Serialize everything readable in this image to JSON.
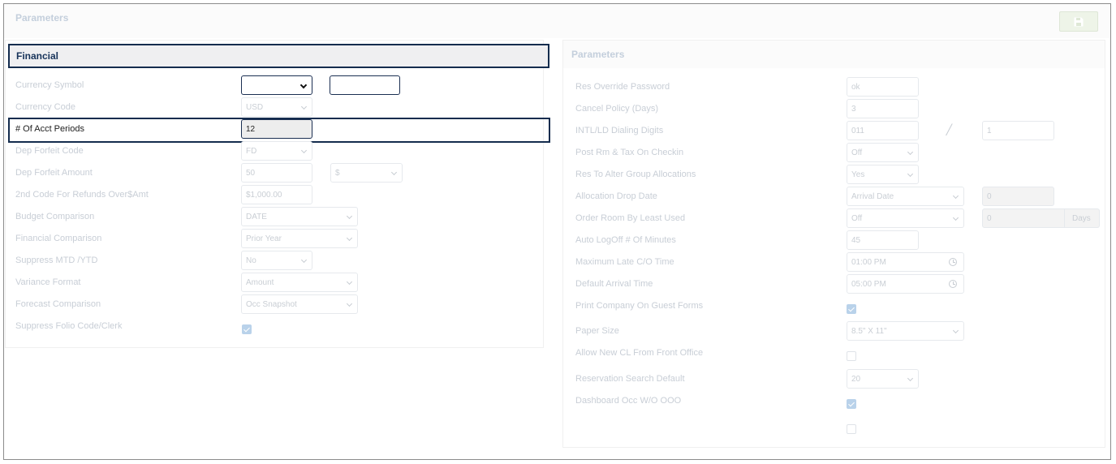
{
  "header": {
    "title": "Parameters",
    "save_icon": "save-icon"
  },
  "financial": {
    "title": "Financial",
    "rows": [
      {
        "label": "Currency Symbol",
        "value": "",
        "value2": ""
      },
      {
        "label": "Currency Code",
        "value": "USD"
      },
      {
        "label": "# Of Acct Periods",
        "value": "12"
      },
      {
        "label": "Dep Forfeit Code",
        "value": "FD"
      },
      {
        "label": "Dep Forfeit Amount",
        "value": "50",
        "value2": "$"
      },
      {
        "label": "2nd Code For Refunds Over$Amt",
        "value": "$1,000.00"
      },
      {
        "label": "Budget Comparison",
        "value": "DATE"
      },
      {
        "label": "Financial Comparison",
        "value": "Prior Year"
      },
      {
        "label": "Suppress MTD /YTD",
        "value": "No"
      },
      {
        "label": "Variance Format",
        "value": "Amount"
      },
      {
        "label": "Forecast Comparison",
        "value": "Occ Snapshot"
      },
      {
        "label": "Suppress Folio Code/Clerk",
        "checked": true
      }
    ]
  },
  "parameters": {
    "title": "Parameters",
    "rows": [
      {
        "label": "Res Override Password",
        "value": "ok"
      },
      {
        "label": "Cancel Policy (Days)",
        "value": "3"
      },
      {
        "label": "INTL/LD Dialing Digits",
        "value": "011",
        "separator": "/",
        "value2": "1"
      },
      {
        "label": "Post Rm & Tax On Checkin",
        "value": "Off"
      },
      {
        "label": "Res To Alter Group Allocations",
        "value": "Yes"
      },
      {
        "label": "Allocation Drop Date",
        "value": "Arrival Date",
        "value2": "0"
      },
      {
        "label": "Order Room By Least Used",
        "value": "Off",
        "value2": "0",
        "addon": "Days"
      },
      {
        "label": "Auto LogOff # Of Minutes",
        "value": "45"
      },
      {
        "label": "Maximum Late C/O Time",
        "value": "01:00 PM"
      },
      {
        "label": "Default Arrival Time",
        "value": "05:00 PM"
      },
      {
        "label": "Print Company On Guest Forms",
        "checked": true
      },
      {
        "label": "Paper Size",
        "value": "8.5\" X 11\""
      },
      {
        "label": "Allow New CL From Front Office",
        "checked": false
      },
      {
        "label": "Reservation Search Default",
        "value": "20"
      },
      {
        "label": "Dashboard Occ W/O OOO",
        "checked": true
      },
      {
        "label": "",
        "checked": false
      }
    ]
  },
  "colors": {
    "accent": "#142c4e",
    "muted_text": "#c8ced6",
    "checkbox": "#b9d2ea"
  }
}
